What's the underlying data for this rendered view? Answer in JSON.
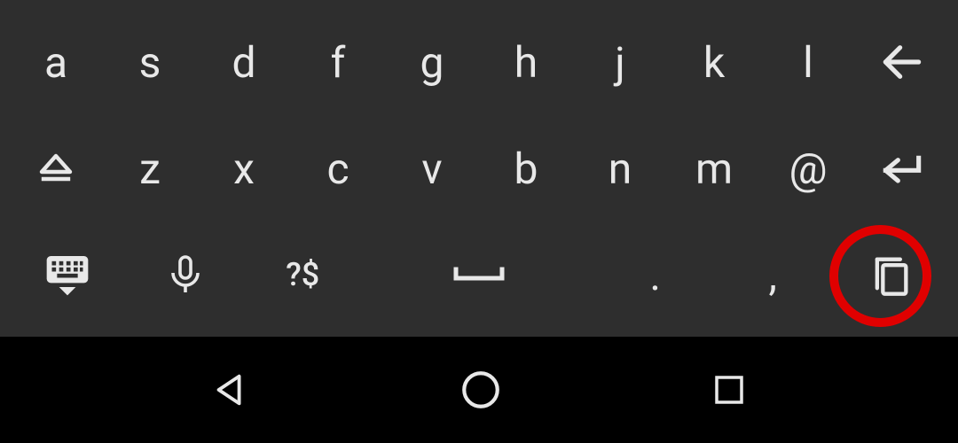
{
  "keyboard": {
    "row1": [
      "a",
      "s",
      "d",
      "f",
      "g",
      "h",
      "j",
      "k",
      "l"
    ],
    "row2": [
      "z",
      "x",
      "c",
      "v",
      "b",
      "n",
      "m",
      "@"
    ],
    "symbols_label": "?$",
    "period": ".",
    "comma": ","
  },
  "highlight": {
    "target": "copy-key"
  }
}
